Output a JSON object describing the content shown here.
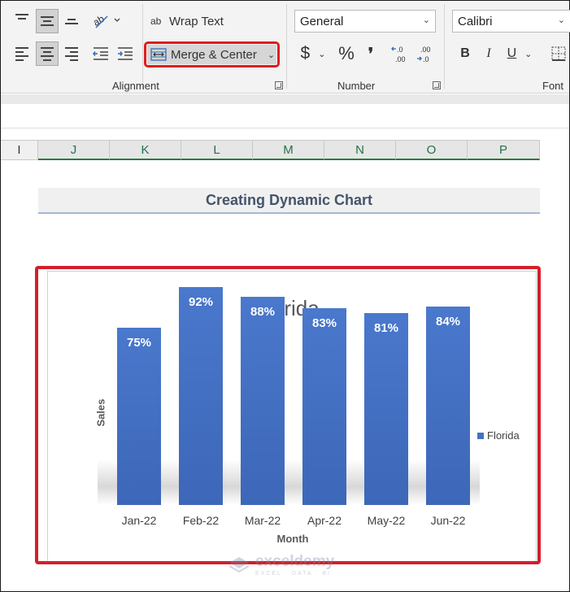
{
  "ribbon": {
    "alignment": {
      "wrap_text": "Wrap Text",
      "wrap_icon": "ab",
      "merge_center": "Merge & Center",
      "group_label": "Alignment"
    },
    "number": {
      "format_value": "General",
      "currency_symbol": "$",
      "percent_symbol": "%",
      "comma_symbol": "❜",
      "increase_decimal": "←.0 .00",
      "decrease_decimal": ".00 →.0",
      "group_label": "Number"
    },
    "font": {
      "font_value": "Calibri",
      "bold": "B",
      "italic": "I",
      "underline": "U",
      "group_label": "Font"
    }
  },
  "columns": [
    "I",
    "J",
    "K",
    "L",
    "M",
    "N",
    "O",
    "P"
  ],
  "sheet": {
    "title": "Creating Dynamic Chart"
  },
  "chart_data": {
    "type": "bar",
    "title": "Florida",
    "xlabel": "Month",
    "ylabel": "Sales",
    "categories": [
      "Jan-22",
      "Feb-22",
      "Mar-22",
      "Apr-22",
      "May-22",
      "Jun-22"
    ],
    "series": [
      {
        "name": "Florida",
        "values": [
          75,
          92,
          88,
          83,
          81,
          84
        ],
        "labels": [
          "75%",
          "92%",
          "88%",
          "83%",
          "81%",
          "84%"
        ],
        "color": "#4472c4"
      }
    ],
    "ylim": [
      0,
      100
    ],
    "legend": "right",
    "grid": false
  },
  "watermark": {
    "name": "exceldemy",
    "sub": "EXCEL · DATA · BI"
  }
}
